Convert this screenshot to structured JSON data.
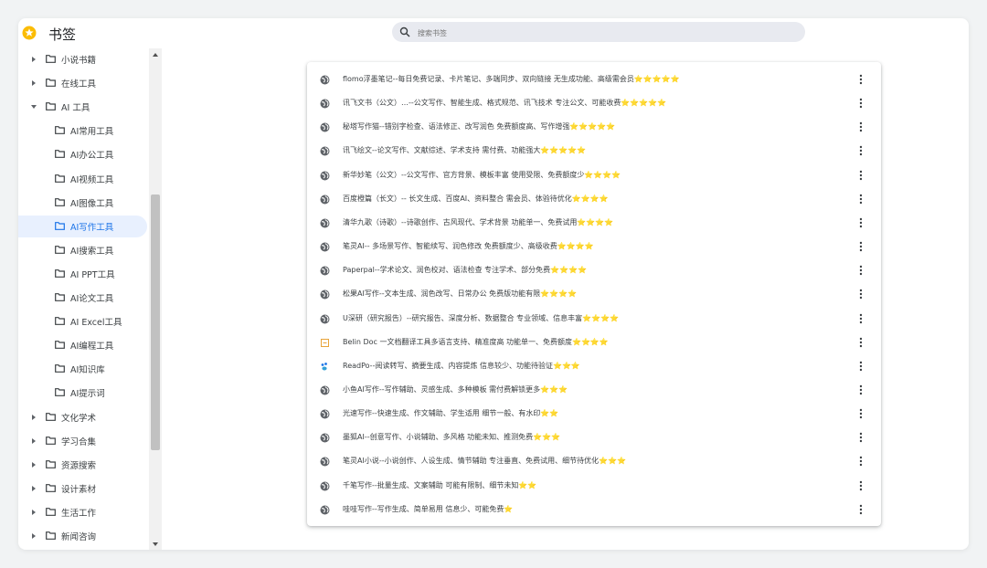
{
  "app": {
    "title": "书签"
  },
  "search": {
    "placeholder": "搜索书签"
  },
  "sidebar": {
    "items": [
      {
        "label": "小说书籍",
        "level": 0,
        "expanded": false
      },
      {
        "label": "在线工具",
        "level": 0,
        "expanded": false
      },
      {
        "label": "AI 工具",
        "level": 0,
        "expanded": true
      },
      {
        "label": "AI常用工具",
        "level": 1
      },
      {
        "label": "AI办公工具",
        "level": 1
      },
      {
        "label": "AI视频工具",
        "level": 1
      },
      {
        "label": "AI图像工具",
        "level": 1
      },
      {
        "label": "AI写作工具",
        "level": 1,
        "active": true
      },
      {
        "label": "AI搜索工具",
        "level": 1
      },
      {
        "label": "AI PPT工具",
        "level": 1
      },
      {
        "label": "AI论文工具",
        "level": 1
      },
      {
        "label": "AI Excel工具",
        "level": 1
      },
      {
        "label": "AI编程工具",
        "level": 1
      },
      {
        "label": "AI知识库",
        "level": 1
      },
      {
        "label": "AI提示词",
        "level": 1
      },
      {
        "label": "文化学术",
        "level": 0,
        "expanded": false
      },
      {
        "label": "学习合集",
        "level": 0,
        "expanded": false
      },
      {
        "label": "资源搜索",
        "level": 0,
        "expanded": false
      },
      {
        "label": "设计素材",
        "level": 0,
        "expanded": false
      },
      {
        "label": "生活工作",
        "level": 0,
        "expanded": false
      },
      {
        "label": "新闻咨询",
        "level": 0,
        "expanded": false
      }
    ]
  },
  "bookmarks": [
    {
      "title": "flomo浮墨笔记--每日免费记录、卡片笔记、多端同步、双向链接 无生成功能、高级需会员",
      "stars": "⭐⭐⭐⭐⭐",
      "icon": "globe-icon"
    },
    {
      "title": "讯飞文书（公文）…--公文写作、智能生成、格式规范、讯飞技术 专注公文、可能收费",
      "stars": "⭐⭐⭐⭐⭐",
      "icon": "globe-icon"
    },
    {
      "title": "秘塔写作猫--错别字检查、语法修正、改写润色 免费额度高、写作增强",
      "stars": "⭐⭐⭐⭐⭐",
      "icon": "globe-icon"
    },
    {
      "title": "讯飞绘文--论文写作、文献综述、学术支持 需付费、功能强大",
      "stars": "⭐⭐⭐⭐⭐",
      "icon": "globe-icon"
    },
    {
      "title": "新华妙笔（公文）--公文写作、官方背景、模板丰富 使用受限、免费额度少",
      "stars": "⭐⭐⭐⭐",
      "icon": "globe-icon"
    },
    {
      "title": "百度橙篇（长文）-- 长文生成、百度AI、资料整合 需会员、体验待优化",
      "stars": "⭐⭐⭐⭐",
      "icon": "globe-icon"
    },
    {
      "title": "清华九歌（诗歌）--诗歌创作、古风现代、学术背景 功能单一、免费试用",
      "stars": "⭐⭐⭐⭐",
      "icon": "globe-icon"
    },
    {
      "title": "笔灵AI-- 多场景写作、智能续写、润色修改 免费额度少、高级收费",
      "stars": "⭐⭐⭐⭐",
      "icon": "globe-icon"
    },
    {
      "title": "Paperpal--学术论文、润色校对、语法检查 专注学术、部分免费",
      "stars": "⭐⭐⭐⭐",
      "icon": "globe-icon"
    },
    {
      "title": "松果AI写作--文本生成、润色改写、日常办公 免费版功能有限",
      "stars": "⭐⭐⭐⭐",
      "icon": "globe-icon"
    },
    {
      "title": "U深研（研究报告）--研究报告、深度分析、数据整合 专业领域、信息丰富",
      "stars": "⭐⭐⭐⭐",
      "icon": "globe-icon"
    },
    {
      "title": "Belin Doc 一文档翻译工具多语言支持、精准度高 功能单一、免费额度",
      "stars": "⭐⭐⭐⭐",
      "icon": "doc-icon"
    },
    {
      "title": "ReadPo--阅读转写、摘要生成、内容提炼 信息较少、功能待验证",
      "stars": "⭐⭐⭐",
      "icon": "paw-icon"
    },
    {
      "title": "小鱼AI写作--写作辅助、灵感生成、多种模板 需付费解锁更多",
      "stars": "⭐⭐⭐",
      "icon": "globe-icon"
    },
    {
      "title": "光速写作--快速生成、作文辅助、学生适用 细节一般、有水印",
      "stars": "⭐⭐",
      "icon": "globe-icon"
    },
    {
      "title": "墨狐AI--创意写作、小说辅助、多风格 功能未知、推测免费",
      "stars": "⭐⭐⭐",
      "icon": "globe-icon"
    },
    {
      "title": "笔灵AI小说--小说创作、人设生成、情节辅助 专注垂直、免费试用、细节待优化",
      "stars": "⭐⭐⭐",
      "icon": "globe-icon"
    },
    {
      "title": "千笔写作--批量生成、文案辅助 可能有限制、细节未知",
      "stars": "⭐⭐",
      "icon": "globe-icon"
    },
    {
      "title": "哇哇写作--写作生成、简单易用 信息少、可能免费",
      "stars": "⭐",
      "icon": "globe-icon"
    }
  ],
  "colors": {
    "accent": "#1a73e8",
    "active_bg": "#e8f0fe",
    "star": "#f6c343"
  }
}
